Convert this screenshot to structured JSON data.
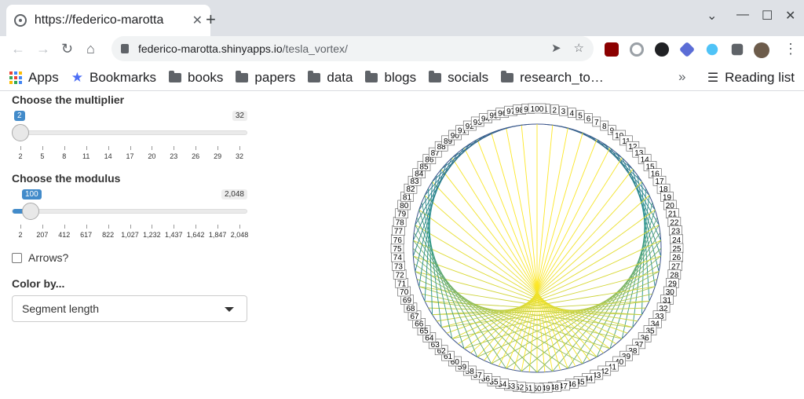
{
  "tab": {
    "title": "https://federico-marotta",
    "favicon": "globe-icon"
  },
  "omnibox": {
    "host": "federico-marotta.shinyapps.io",
    "path": "/tesla_vortex/"
  },
  "bookmarks": {
    "apps_label": "Apps",
    "star_label": "Bookmarks",
    "folders": [
      "books",
      "papers",
      "data",
      "blogs",
      "socials",
      "research_to…"
    ],
    "overflow": "»",
    "reading_list": "Reading list"
  },
  "controls": {
    "multiplier": {
      "label": "Choose the multiplier",
      "value": "2",
      "max_label": "32",
      "min": 2,
      "max": 32,
      "current": 2,
      "ticks": [
        "2",
        "5",
        "8",
        "11",
        "14",
        "17",
        "20",
        "23",
        "26",
        "29",
        "32"
      ]
    },
    "modulus": {
      "label": "Choose the modulus",
      "value": "100",
      "max_label": "2,048",
      "min": 2,
      "max": 2048,
      "current": 100,
      "ticks": [
        "2",
        "207",
        "412",
        "617",
        "822",
        "1,027",
        "1,232",
        "1,437",
        "1,642",
        "1,847",
        "2,048"
      ]
    },
    "arrows": {
      "label": "Arrows?",
      "checked": false
    },
    "color_by": {
      "label": "Color by...",
      "selected": "Segment length"
    }
  },
  "chart_data": {
    "type": "line",
    "title": "",
    "multiplier": 2,
    "modulus": 100,
    "color_by": "Segment length",
    "colors": {
      "short": "#3b528b",
      "mid": "#21908d",
      "long": "#fde725"
    }
  }
}
